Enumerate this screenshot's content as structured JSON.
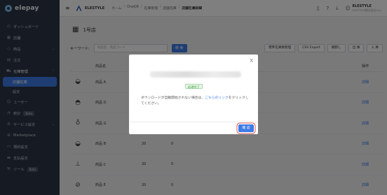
{
  "brand": {
    "name": "elepay"
  },
  "sidebar": {
    "items": [
      {
        "label": "ダッシュボード",
        "icon": "clock-icon"
      },
      {
        "label": "店舗",
        "icon": "store-icon"
      },
      {
        "label": "商品",
        "icon": "tag-icon",
        "chevron": true
      },
      {
        "label": "注文",
        "icon": "receipt-icon"
      },
      {
        "label": "在庫管理",
        "icon": "cart-icon",
        "chevron": true,
        "open": true
      },
      {
        "label": "ユーザー",
        "icon": "user-icon"
      },
      {
        "label": "統計",
        "icon": "chart-icon",
        "badge": "Beta"
      },
      {
        "label": "サービス設定",
        "icon": "gear-icon",
        "chevron": true
      },
      {
        "label": "Marketplace",
        "icon": "grid-icon"
      },
      {
        "label": "規約設定",
        "icon": "document-icon"
      },
      {
        "label": "支払設定",
        "icon": "card-icon"
      },
      {
        "label": "ツール",
        "icon": "wrench-icon",
        "badge": "Beta"
      }
    ],
    "subitems": [
      {
        "label": "店舗在庫",
        "active": true
      },
      {
        "label": "設定",
        "active": false
      }
    ]
  },
  "header": {
    "store_name": "ELESTYLE",
    "breadcrumbs": [
      "ホーム",
      "OneQR",
      "在庫管理",
      "店舗在庫",
      "店舗在庫詳細"
    ],
    "user_name": "ELESTYLE",
    "user_email": "ELESTYLE株式会社(en)"
  },
  "page": {
    "title": "1号店",
    "keyword_label": "キーワード:",
    "keyword_placeholder": "商品名、商品コード",
    "search_label": "検 索",
    "buttons": [
      "標準在庫数管理",
      "CSV Export",
      "棚卸し",
      "出 庫",
      "入 庫"
    ]
  },
  "table": {
    "headers": {
      "name": "商品名",
      "action": "操作"
    },
    "rows": [
      {
        "icon": "bowl-icon",
        "name": "商品 A",
        "n1": "",
        "n2": "",
        "action": "詳細"
      },
      {
        "icon": "platter-icon",
        "name": "商品 D",
        "n1": "",
        "n2": "",
        "action": "詳細"
      },
      {
        "icon": "bottle-icon",
        "name": "商品 G",
        "n1": "",
        "n2": "",
        "action": "詳細"
      },
      {
        "icon": "bowl-icon",
        "name": "商品 B",
        "n1": "20",
        "n2": "0",
        "action": "詳細"
      },
      {
        "icon": "grill-icon",
        "name": "商品 C",
        "n1": "20",
        "n2": "0",
        "action": "詳細"
      },
      {
        "icon": "sushi-icon",
        "name": "商品 E",
        "n1": "20",
        "n2": "0",
        "action": "詳細"
      }
    ]
  },
  "modal": {
    "status_tag": "処理完了",
    "message_prefix": "ダウンロードが自動開始されない場合は、",
    "message_link": "こちらのリンク",
    "message_suffix": "をクリックしてください。",
    "ok_label": "確 認",
    "close_symbol": "X"
  },
  "colors": {
    "accent": "#3d7be6",
    "sidebar_bg": "#2b3547",
    "status_green": "#3a9a3a"
  }
}
